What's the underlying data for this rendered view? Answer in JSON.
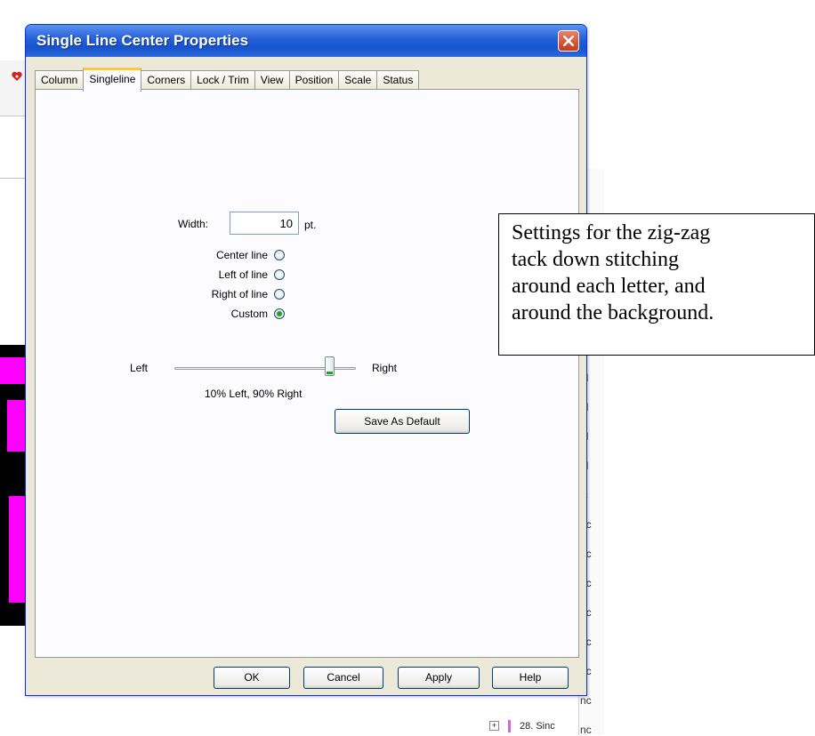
{
  "dialog": {
    "title": "Single Line Center Properties",
    "tabs": [
      "Column",
      "Singleline",
      "Corners",
      "Lock / Trim",
      "View",
      "Position",
      "Scale",
      "Status"
    ],
    "active_tab": "Singleline",
    "width_label": "Width:",
    "width_value": "10",
    "width_unit": "pt.",
    "radios": [
      {
        "label": "Center line",
        "checked": false
      },
      {
        "label": "Left of line",
        "checked": false
      },
      {
        "label": "Right of line",
        "checked": false
      },
      {
        "label": "Custom",
        "checked": true
      }
    ],
    "slider": {
      "left_label": "Left",
      "right_label": "Right",
      "value_fraction": 0.9,
      "caption": "10% Left,  90% Right"
    },
    "save_default_label": "Save As Default",
    "buttons": {
      "ok": "OK",
      "cancel": "Cancel",
      "apply": "Apply",
      "help": "Help"
    }
  },
  "annotation": {
    "lines": [
      "Settings for the zig-zag",
      "tack down stitching",
      "around each letter, and",
      "around the background."
    ]
  },
  "background": {
    "right_panel_items": [
      "al",
      "al",
      "al",
      "al",
      "lc",
      "nc",
      "nc",
      "nc",
      "nc",
      "nc",
      "nc",
      "nc",
      "nc"
    ],
    "tree_item": "28. Sinc"
  },
  "colors": {
    "title_bar": "#2b63d8",
    "artwork_magenta": "#ff00ff",
    "radio_dot": "#21a121",
    "tab_highlight": "#ffc83c"
  }
}
